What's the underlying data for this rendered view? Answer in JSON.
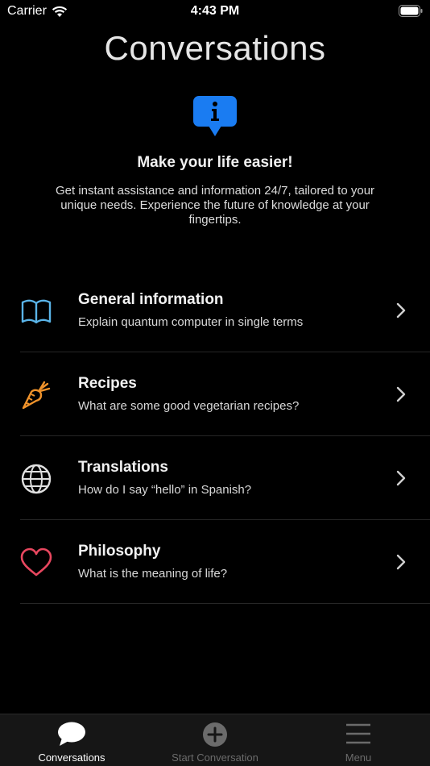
{
  "status": {
    "carrier": "Carrier",
    "time": "4:43 PM"
  },
  "header": {
    "title": "Conversations"
  },
  "intro": {
    "headline": "Make your life easier!",
    "description": "Get instant assistance and information 24/7, tailored to your unique needs. Experience the future of knowledge at your fingertips."
  },
  "topics": [
    {
      "title": "General information",
      "subtitle": "Explain quantum computer in single terms",
      "icon": "book-icon",
      "color": "#5ab4e8"
    },
    {
      "title": "Recipes",
      "subtitle": "What are some good vegetarian recipes?",
      "icon": "carrot-icon",
      "color": "#f0932b"
    },
    {
      "title": "Translations",
      "subtitle": "How do I say “hello” in Spanish?",
      "icon": "globe-icon",
      "color": "#e0e0e0"
    },
    {
      "title": "Philosophy",
      "subtitle": "What is the meaning of life?",
      "icon": "heart-icon",
      "color": "#e8475f"
    }
  ],
  "tabbar": {
    "tabs": [
      {
        "label": "Conversations",
        "icon": "chat-bubble-icon",
        "active": true
      },
      {
        "label": "Start Conversation",
        "icon": "plus-circle-icon",
        "active": false
      },
      {
        "label": "Menu",
        "icon": "hamburger-icon",
        "active": false
      }
    ]
  },
  "colors": {
    "accent": "#1a7cf2",
    "background": "#000000",
    "tabbar": "#161616",
    "inactive": "#6b6b6b"
  }
}
